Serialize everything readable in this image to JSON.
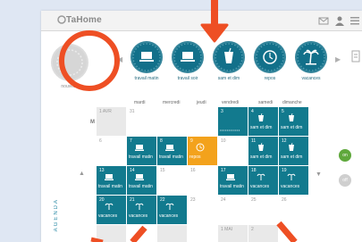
{
  "app": {
    "brand": "TaHome"
  },
  "strip": {
    "items": [
      {
        "label": "nouveau",
        "icon": "calendar-icon",
        "style": "grey"
      },
      {
        "label": "travail matin",
        "icon": "laptop-icon"
      },
      {
        "label": "travail soir",
        "icon": "laptop-icon"
      },
      {
        "label": "sam et dim",
        "icon": "drink-icon"
      },
      {
        "label": "repos",
        "icon": "clock-icon"
      },
      {
        "label": "vacances",
        "icon": "palm-tree-icon"
      }
    ]
  },
  "calendar": {
    "weekdays": [
      "mardi",
      "mercredi",
      "jeudi",
      "vendredi",
      "samedi",
      "dimanche"
    ],
    "month_letter": "M",
    "cells": [
      {
        "num": "1 AVR",
        "label": "",
        "style": "grey"
      },
      {
        "num": "31",
        "label": "",
        "style": "white"
      },
      {
        "num": "",
        "label": "",
        "style": "white"
      },
      {
        "num": "",
        "label": "",
        "style": "white"
      },
      {
        "num": "3",
        "label": "",
        "style": "teal",
        "dots": "••••••••••••"
      },
      {
        "num": "4",
        "label": "sam et dim",
        "style": "teal"
      },
      {
        "num": "5",
        "label": "sam et dim",
        "style": "teal"
      },
      {
        "num": "6",
        "label": "",
        "style": "white"
      },
      {
        "num": "7",
        "label": "travail matin",
        "style": "teal"
      },
      {
        "num": "8",
        "label": "travail matin",
        "style": "teal"
      },
      {
        "num": "9",
        "label": "repos",
        "style": "orange"
      },
      {
        "num": "10",
        "label": "",
        "style": "white"
      },
      {
        "num": "11",
        "label": "sam et dim",
        "style": "teal"
      },
      {
        "num": "12",
        "label": "sam et dim",
        "style": "teal"
      },
      {
        "num": "13",
        "label": "travail matin",
        "style": "teal"
      },
      {
        "num": "14",
        "label": "travail matin",
        "style": "teal"
      },
      {
        "num": "15",
        "label": "",
        "style": "white"
      },
      {
        "num": "16",
        "label": "",
        "style": "white"
      },
      {
        "num": "17",
        "label": "travail matin",
        "style": "teal"
      },
      {
        "num": "18",
        "label": "vacances",
        "style": "teal"
      },
      {
        "num": "19",
        "label": "vacances",
        "style": "teal"
      },
      {
        "num": "20",
        "label": "vacances",
        "style": "teal"
      },
      {
        "num": "21",
        "label": "vacances",
        "style": "teal"
      },
      {
        "num": "22",
        "label": "vacances",
        "style": "teal"
      },
      {
        "num": "23",
        "label": "",
        "style": "white"
      },
      {
        "num": "24",
        "label": "",
        "style": "white"
      },
      {
        "num": "25",
        "label": "",
        "style": "white"
      },
      {
        "num": "26",
        "label": "",
        "style": "white"
      },
      {
        "num": "",
        "label": "",
        "style": "grey"
      },
      {
        "num": "",
        "label": "",
        "style": "white"
      },
      {
        "num": "",
        "label": "",
        "style": "grey"
      },
      {
        "num": "",
        "label": "",
        "style": "white"
      },
      {
        "num": "1 MAI",
        "label": "",
        "style": "grey"
      },
      {
        "num": "2",
        "label": "",
        "style": "grey"
      },
      {
        "num": "",
        "label": "",
        "style": "white"
      }
    ]
  },
  "side": {
    "agenda": "AGENDA",
    "toggle_on": "on",
    "toggle_off": "off"
  },
  "colors": {
    "teal": "#127a8e",
    "orange": "#f3a21c",
    "annotation": "#ee4f24"
  }
}
